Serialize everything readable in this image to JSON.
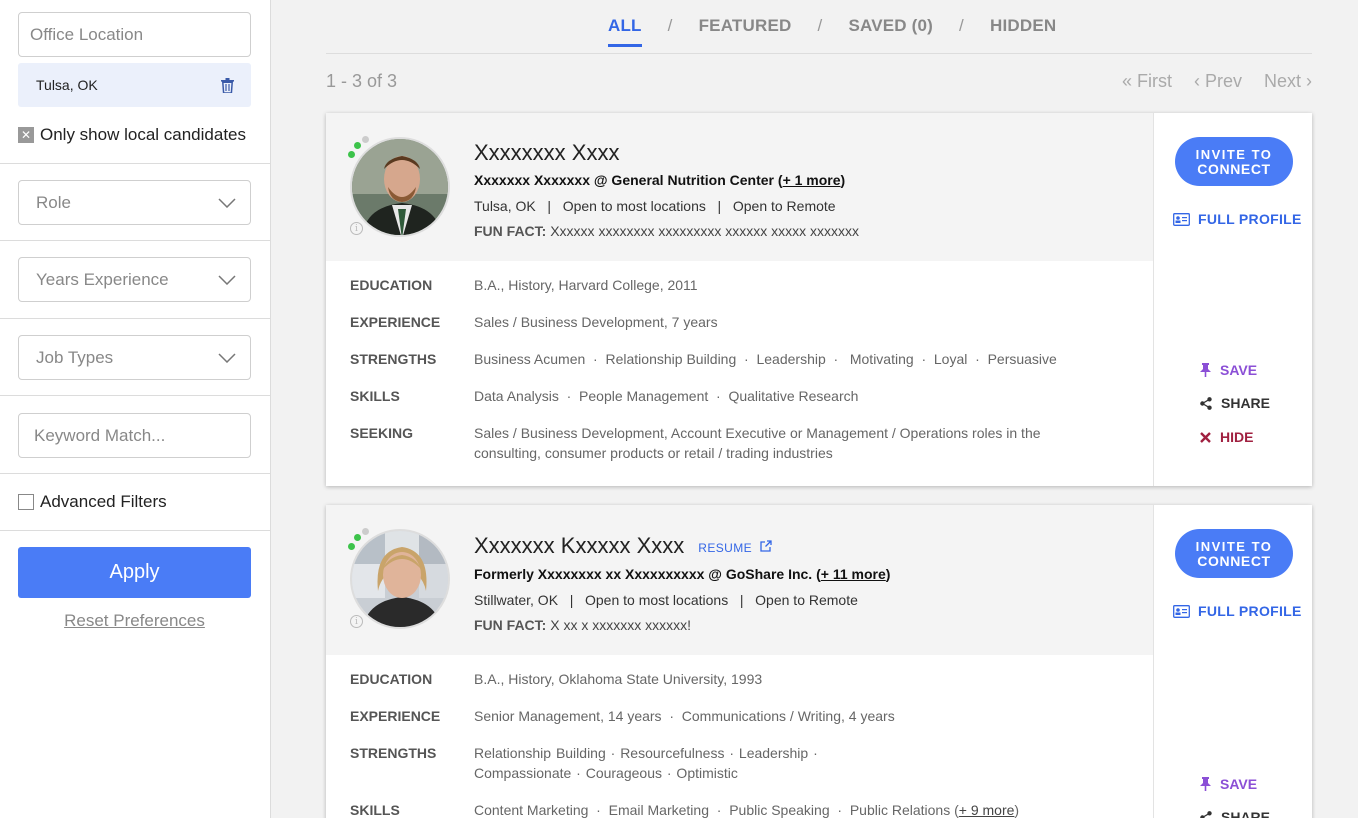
{
  "sidebar": {
    "office_location_placeholder": "Office Location",
    "selected_location": "Tulsa, OK",
    "local_only_label": "Only show local candidates",
    "role_label": "Role",
    "years_label": "Years Experience",
    "job_types_label": "Job Types",
    "keyword_placeholder": "Keyword Match...",
    "advanced_label": "Advanced Filters",
    "apply_label": "Apply",
    "reset_label": "Reset Preferences"
  },
  "tabs": {
    "all": "ALL",
    "featured": "FEATURED",
    "saved": "SAVED (0)",
    "hidden": "HIDDEN",
    "sep": "/"
  },
  "results": {
    "count": "1 - 3 of 3",
    "first": "First",
    "prev": "Prev",
    "next": "Next"
  },
  "labels": {
    "education": "EDUCATION",
    "experience": "EXPERIENCE",
    "strengths": "STRENGTHS",
    "skills": "SKILLS",
    "seeking": "SEEKING",
    "fun_fact": "FUN FACT:",
    "invite_top": "INVITE TO",
    "invite_bottom": "CONNECT",
    "full_profile": "FULL PROFILE",
    "save": "SAVE",
    "share": "SHARE",
    "hide": "HIDE",
    "resume": "RESUME"
  },
  "candidates": [
    {
      "name": "Xxxxxxxx Xxxx",
      "headline": "Xxxxxxx Xxxxxxx @ General Nutrition Center (",
      "headline_more": "+ 1 more",
      "headline_end": ")",
      "location_line": "Tulsa, OK   |   Open to most locations   |   Open to Remote",
      "fun_fact": "Xxxxxx xxxxxxxx xxxxxxxxx xxxxxx xxxxx xxxxxxx",
      "education": "B.A., History, Harvard College, 2011",
      "experience": "Sales / Business Development, 7 years",
      "strengths": "Business Acumen  ·  Relationship Building  ·  Leadership  ·   Motivating  ·  Loyal  ·  Persuasive",
      "skills": "Data Analysis  ·  People Management  ·  Qualitative Research",
      "seeking": "Sales / Business Development, Account Executive or Management / Operations roles in the consulting, consumer products or retail / trading industries"
    },
    {
      "name": "Xxxxxxx Kxxxxx Xxxx",
      "headline": "Formerly Xxxxxxxx xx Xxxxxxxxxx @ GoShare Inc. (",
      "headline_more": "+ 11 more",
      "headline_end": ")",
      "location_line": "Stillwater, OK   |   Open to most locations   |   Open to Remote",
      "fun_fact": "X xx x xxxxxxx xxxxxx!",
      "education": "B.A., History, Oklahoma State University, 1993",
      "experience": "Senior Management, 14 years  ·  Communications / Writing, 4 years",
      "strengths": "Relationship Building  ·  Resourcefulness  ·  Leadership  ·  Compassionate  ·  Courageous  ·  Optimistic",
      "skills": "Content Marketing  ·  Email Marketing  ·  Public Speaking  ·  Public Relations (",
      "skills_more": "+ 9 more",
      "skills_end": ")"
    }
  ],
  "colors": {
    "accent": "#4a7cf6",
    "save": "#8b4fd6",
    "hide": "#a02040"
  }
}
